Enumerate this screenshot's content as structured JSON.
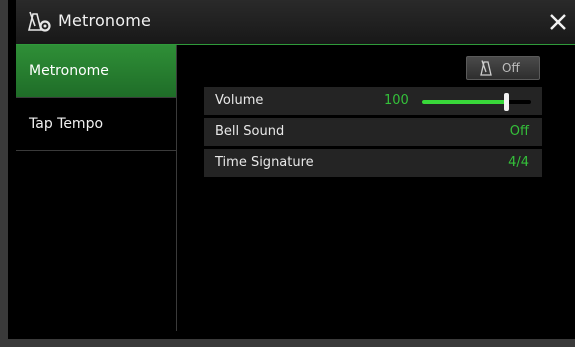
{
  "window": {
    "title": "Metronome",
    "accent_color": "#2f9a3a"
  },
  "sidebar": {
    "items": [
      {
        "label": "Metronome",
        "active": true
      },
      {
        "label": "Tap Tempo",
        "active": false
      }
    ]
  },
  "toggle": {
    "label": "Off",
    "icon": "metronome-icon"
  },
  "params": {
    "volume": {
      "label": "Volume",
      "value": "100",
      "level_fraction": 0.77
    },
    "bell_sound": {
      "label": "Bell Sound",
      "value": "Off"
    },
    "time_signature": {
      "label": "Time Signature",
      "value": "4/4"
    }
  }
}
